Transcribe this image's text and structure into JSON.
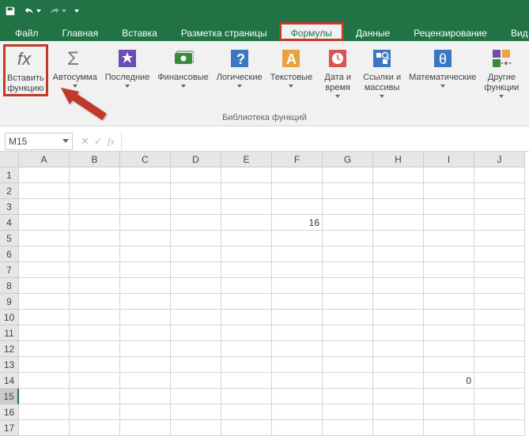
{
  "qat": {
    "save": "save",
    "undo": "undo",
    "redo": "redo"
  },
  "tabs": {
    "file": "Файл",
    "home": "Главная",
    "insert": "Вставка",
    "layout": "Разметка страницы",
    "formulas": "Формулы",
    "data": "Данные",
    "review": "Рецензирование",
    "view": "Вид",
    "active": "formulas"
  },
  "ribbon": {
    "insert_fn_l1": "Вставить",
    "insert_fn_l2": "функцию",
    "autosum": "Автосумма",
    "recent": "Последние",
    "financial": "Финансовые",
    "logical": "Логические",
    "text": "Текстовые",
    "datetime_l1": "Дата и",
    "datetime_l2": "время",
    "lookup_l1": "Ссылки и",
    "lookup_l2": "массивы",
    "math": "Математические",
    "more_l1": "Другие",
    "more_l2": "функции",
    "group_label": "Библиотека функций"
  },
  "namebox": {
    "value": "M15"
  },
  "fx": {
    "cancel": "✕",
    "enter": "✓",
    "fx": "fx"
  },
  "columns": [
    "A",
    "B",
    "C",
    "D",
    "E",
    "F",
    "G",
    "H",
    "I",
    "J"
  ],
  "rows": [
    "1",
    "2",
    "3",
    "4",
    "5",
    "6",
    "7",
    "8",
    "9",
    "10",
    "11",
    "12",
    "13",
    "14",
    "15",
    "16",
    "17"
  ],
  "cells": {
    "F4": "16",
    "I14": "0"
  },
  "selection": {
    "row": 15
  }
}
